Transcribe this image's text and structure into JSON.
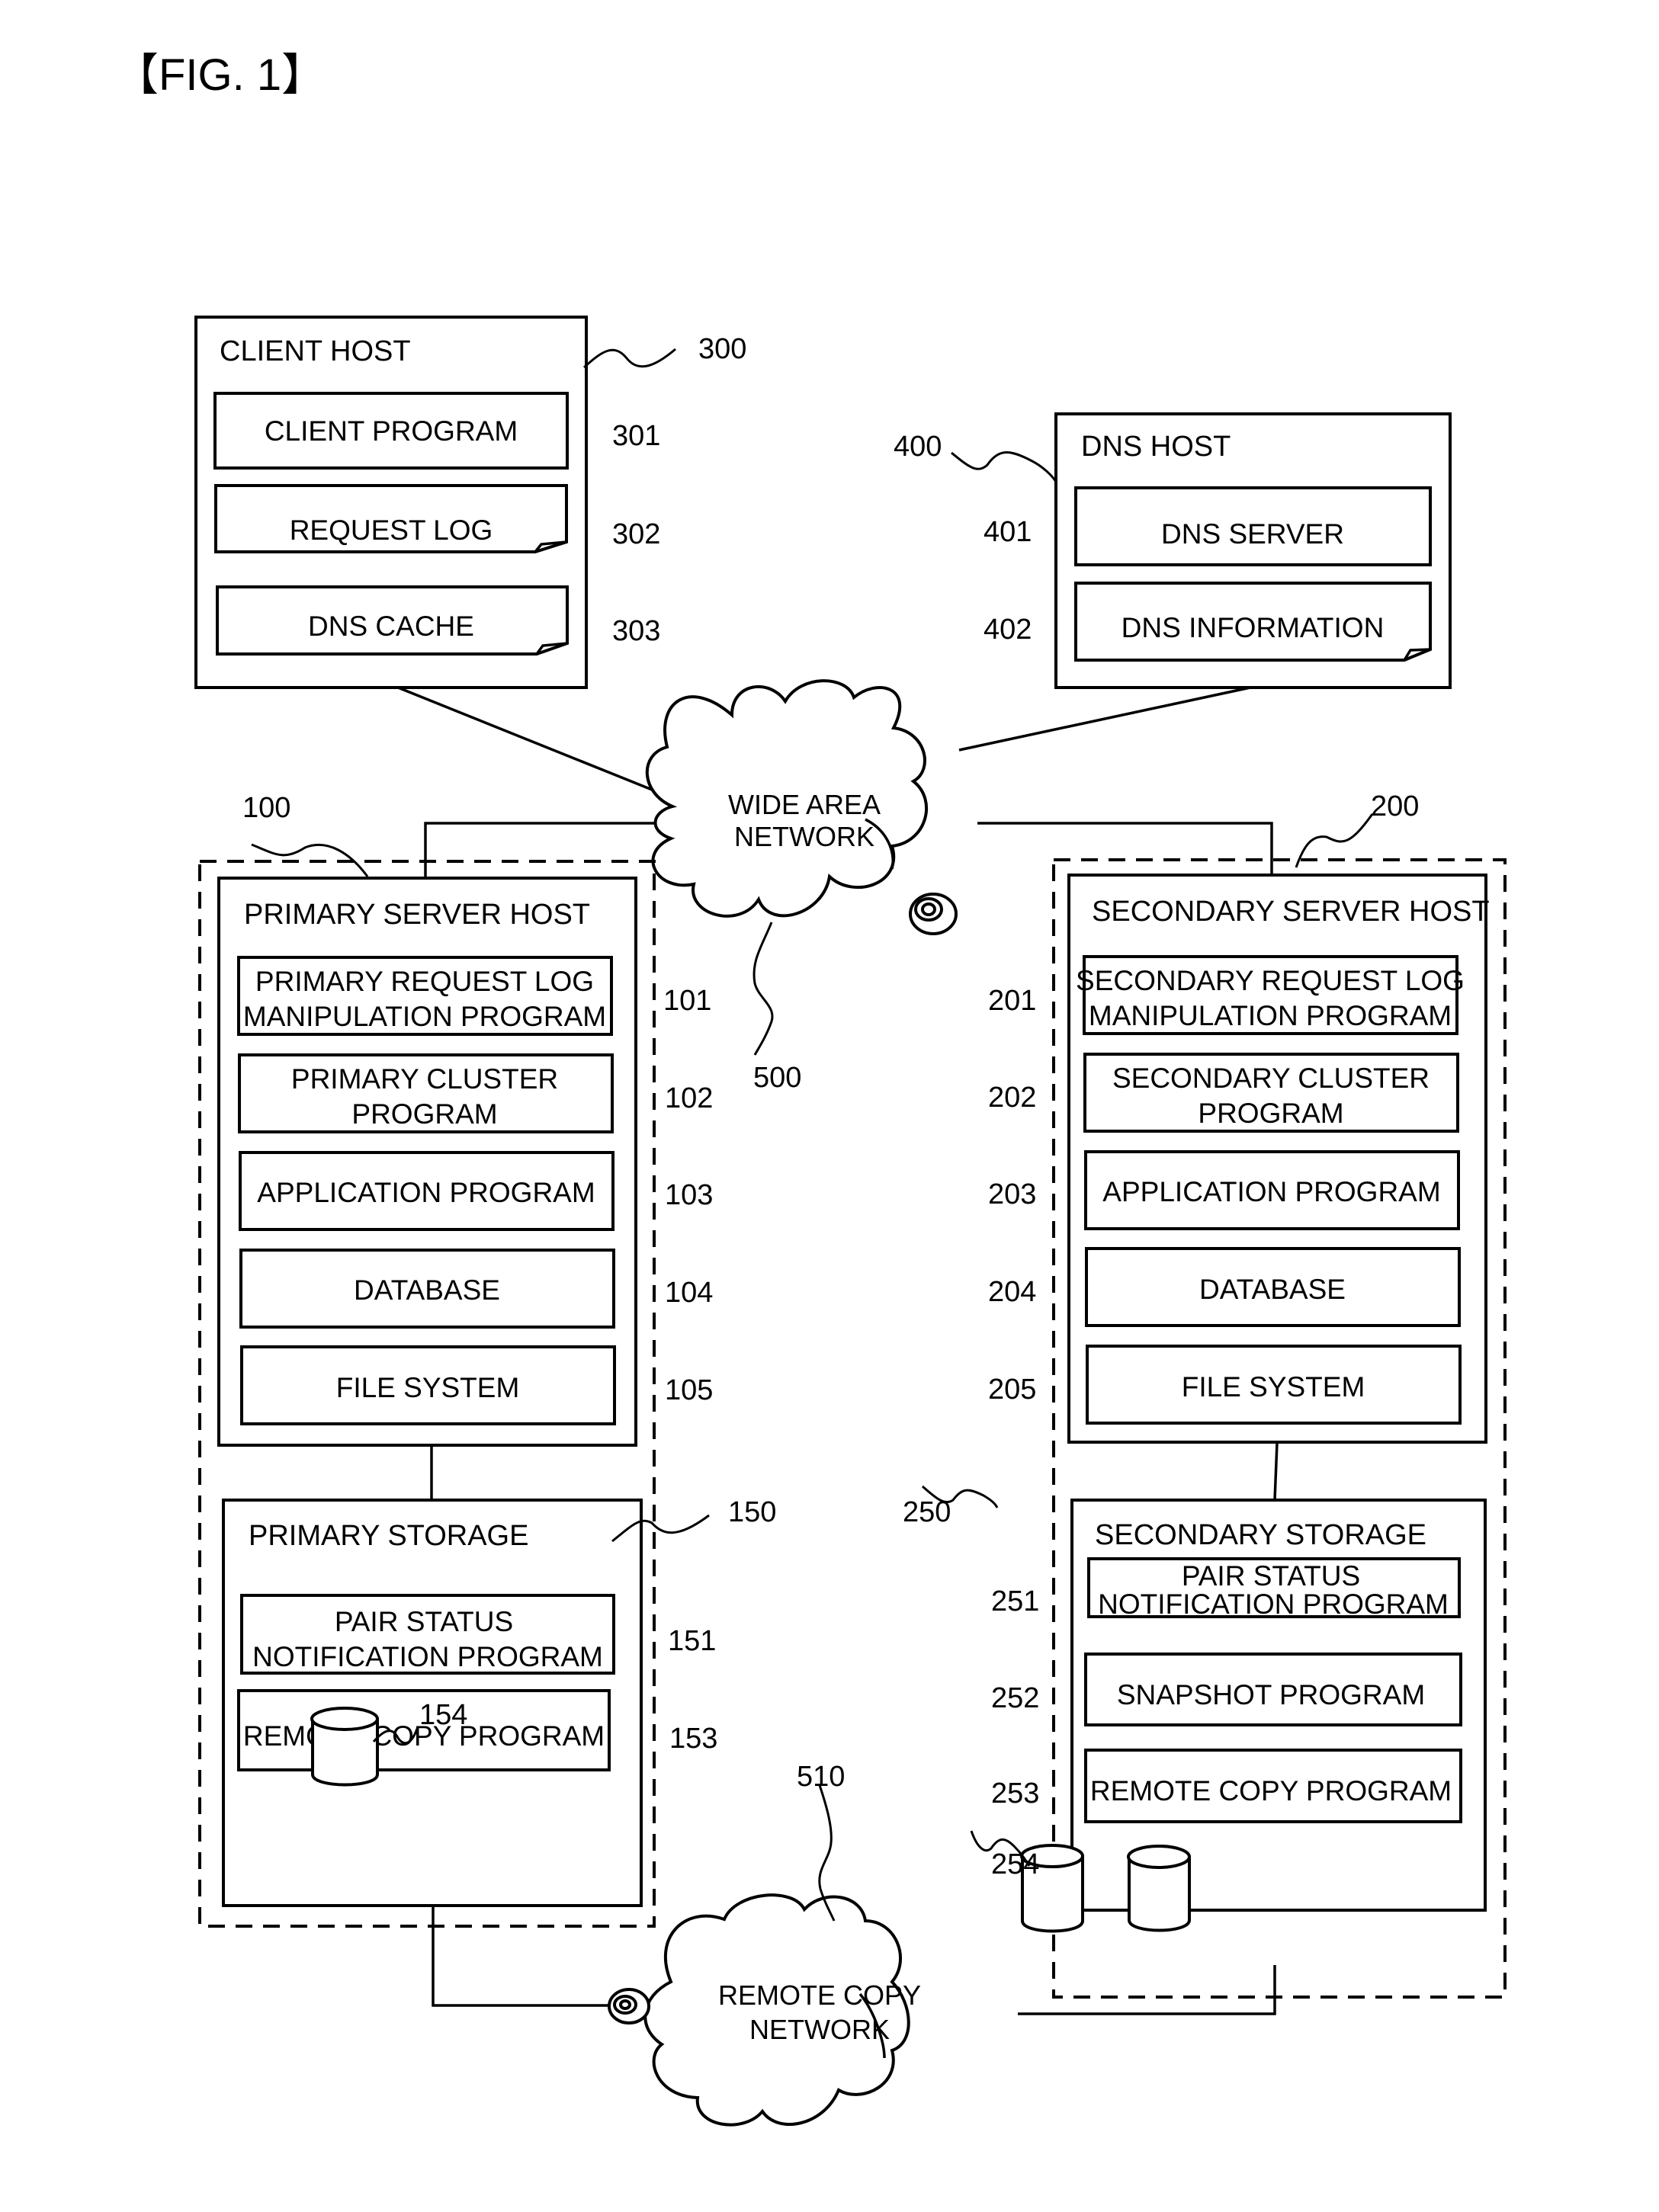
{
  "figure_label": "【FIG. 1】",
  "client_host": {
    "title": "CLIENT HOST",
    "ref": "300",
    "items": [
      {
        "label": "CLIENT PROGRAM",
        "ref": "301",
        "kind": "program"
      },
      {
        "label": "REQUEST LOG",
        "ref": "302",
        "kind": "data"
      },
      {
        "label": "DNS CACHE",
        "ref": "303",
        "kind": "data"
      }
    ]
  },
  "dns_host": {
    "title": "DNS HOST",
    "ref": "400",
    "items": [
      {
        "label": "DNS SERVER",
        "ref": "401",
        "kind": "program"
      },
      {
        "label": "DNS INFORMATION",
        "ref": "402",
        "kind": "data"
      }
    ]
  },
  "wide_area_network": {
    "line1": "WIDE AREA",
    "line2": "NETWORK",
    "ref": "500"
  },
  "primary_site": {
    "ref": "100",
    "server_host": {
      "title": "PRIMARY SERVER HOST",
      "items": [
        {
          "line1": "PRIMARY REQUEST LOG",
          "line2": "MANIPULATION PROGRAM",
          "ref": "101"
        },
        {
          "line1": "PRIMARY CLUSTER",
          "line2": "PROGRAM",
          "ref": "102"
        },
        {
          "line1": "APPLICATION PROGRAM",
          "line2": "",
          "ref": "103"
        },
        {
          "line1": "DATABASE",
          "line2": "",
          "ref": "104"
        },
        {
          "line1": "FILE SYSTEM",
          "line2": "",
          "ref": "105"
        }
      ]
    },
    "storage": {
      "title": "PRIMARY STORAGE",
      "ref": "150",
      "items": [
        {
          "line1": "PAIR STATUS",
          "line2": "NOTIFICATION PROGRAM",
          "ref": "151"
        },
        {
          "line1": "REMOTE COPY PROGRAM",
          "line2": "",
          "ref": "153"
        }
      ],
      "volume_ref": "154"
    }
  },
  "secondary_site": {
    "ref": "200",
    "server_host": {
      "title": "SECONDARY SERVER HOST",
      "items": [
        {
          "line1": "SECONDARY REQUEST LOG",
          "line2": "MANIPULATION PROGRAM",
          "ref": "201"
        },
        {
          "line1": "SECONDARY CLUSTER",
          "line2": "PROGRAM",
          "ref": "202"
        },
        {
          "line1": "APPLICATION PROGRAM",
          "line2": "",
          "ref": "203"
        },
        {
          "line1": "DATABASE",
          "line2": "",
          "ref": "204"
        },
        {
          "line1": "FILE SYSTEM",
          "line2": "",
          "ref": "205"
        }
      ]
    },
    "storage": {
      "title": "SECONDARY STORAGE",
      "ref": "250",
      "items": [
        {
          "line1": "PAIR STATUS",
          "line2": "NOTIFICATION PROGRAM",
          "ref": "251"
        },
        {
          "line1": "SNAPSHOT PROGRAM",
          "line2": "",
          "ref": "252"
        },
        {
          "line1": "REMOTE COPY PROGRAM",
          "line2": "",
          "ref": "253"
        }
      ],
      "volume_ref": "254",
      "volume_count": 2
    }
  },
  "remote_copy_network": {
    "line1": "REMOTE COPY",
    "line2": "NETWORK",
    "ref": "510"
  }
}
